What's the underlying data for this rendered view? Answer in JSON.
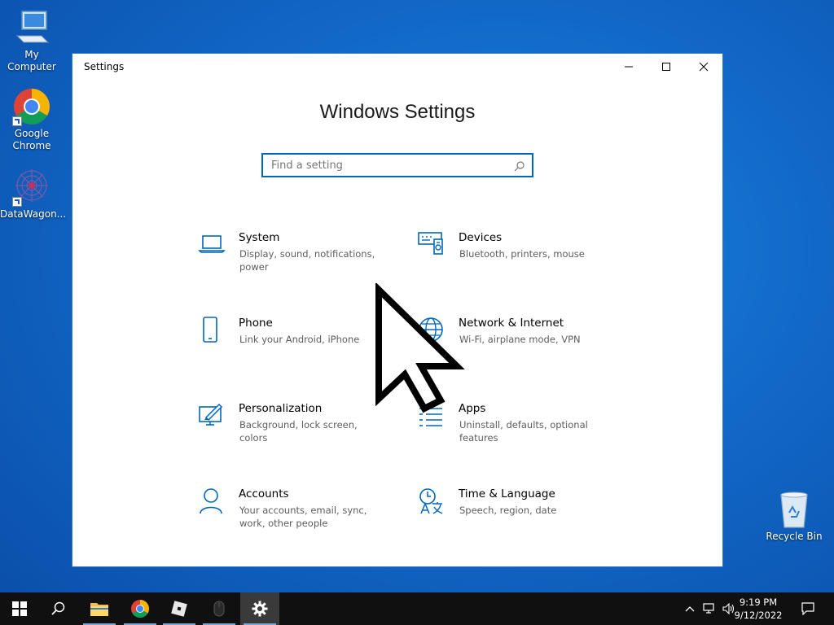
{
  "desktop": {
    "icons": [
      {
        "label": "My Computer"
      },
      {
        "label": "Google Chrome"
      },
      {
        "label": "DataWagon..."
      },
      {
        "label": "Recycle Bin"
      }
    ]
  },
  "window": {
    "title": "Settings",
    "heading": "Windows Settings",
    "search_placeholder": "Find a setting",
    "accent_color": "#0067c0",
    "tiles": [
      {
        "title": "System",
        "desc": "Display, sound, notifications, power",
        "icon": "laptop-icon"
      },
      {
        "title": "Devices",
        "desc": "Bluetooth, printers, mouse",
        "icon": "devices-icon"
      },
      {
        "title": "Phone",
        "desc": "Link your Android, iPhone",
        "icon": "phone-icon"
      },
      {
        "title": "Network & Internet",
        "desc": "Wi-Fi, airplane mode, VPN",
        "icon": "globe-icon"
      },
      {
        "title": "Personalization",
        "desc": "Background, lock screen, colors",
        "icon": "personalization-icon"
      },
      {
        "title": "Apps",
        "desc": "Uninstall, defaults, optional features",
        "icon": "apps-icon"
      },
      {
        "title": "Accounts",
        "desc": "Your accounts, email, sync, work, other people",
        "icon": "person-icon"
      },
      {
        "title": "Time & Language",
        "desc": "Speech, region, date",
        "icon": "time-language-icon"
      }
    ]
  },
  "taskbar": {
    "time": "9:19 PM",
    "date": "9/12/2022"
  }
}
